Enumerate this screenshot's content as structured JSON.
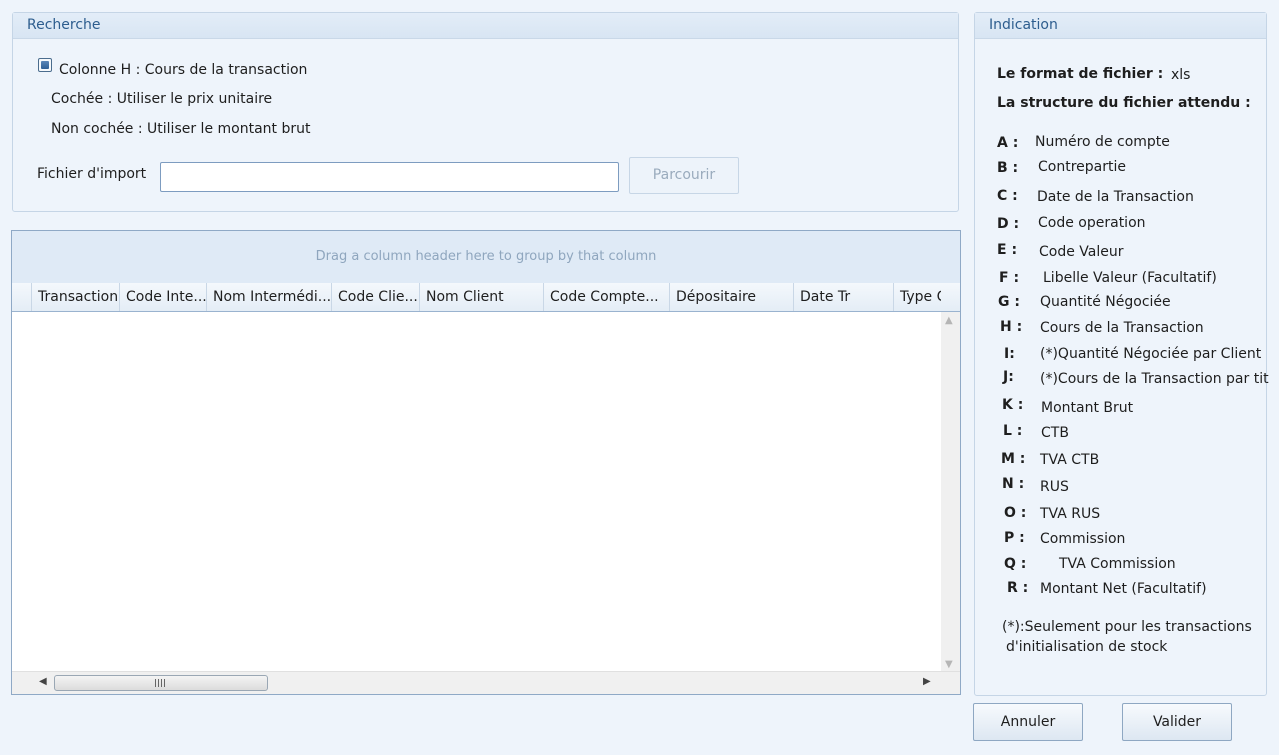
{
  "search_panel": {
    "title": "Recherche",
    "checkbox_label": "Colonne H : Cours de la transaction",
    "checked_hint": "Cochée : Utiliser le prix unitaire",
    "unchecked_hint": "Non cochée : Utiliser le montant brut",
    "file_label": "Fichier d'import",
    "file_value": "",
    "browse_button": "Parcourir"
  },
  "grid": {
    "group_hint": "Drag a column header here to group by that column",
    "columns": [
      "Transaction",
      "Code Inte...",
      "Nom Intermédi...",
      "Code Clie...",
      "Nom Client",
      "Code Compte...",
      "Dépositaire",
      "Date Tr",
      "Type C"
    ]
  },
  "info_panel": {
    "title": "Indication",
    "format_label": "Le format de fichier :",
    "format_value": "xls",
    "structure_label": "La structure du fichier attendu :",
    "fields": [
      {
        "key": "A :",
        "value": "Numéro de compte"
      },
      {
        "key": "B :",
        "value": "Contrepartie"
      },
      {
        "key": "C :",
        "value": "Date de la Transaction"
      },
      {
        "key": "D :",
        "value": "Code operation"
      },
      {
        "key": "E :",
        "value": "Code Valeur"
      },
      {
        "key": "F :",
        "value": "Libelle Valeur (Facultatif)"
      },
      {
        "key": "G :",
        "value": "Quantité Négociée"
      },
      {
        "key": "H :",
        "value": "Cours de la Transaction"
      },
      {
        "key": "I:",
        "value": "(*)Quantité Négociée par Client"
      },
      {
        "key": "J:",
        "value": "(*)Cours de la Transaction par tit"
      },
      {
        "key": "K :",
        "value": "Montant Brut"
      },
      {
        "key": "L :",
        "value": "CTB"
      },
      {
        "key": "M :",
        "value": "TVA CTB"
      },
      {
        "key": "N :",
        "value": "RUS"
      },
      {
        "key": "O :",
        "value": "TVA RUS"
      },
      {
        "key": "P :",
        "value": "Commission"
      },
      {
        "key": "Q :",
        "value": "TVA Commission"
      },
      {
        "key": "R :",
        "value": "Montant Net (Facultatif)"
      }
    ],
    "footnote_line1": "(*):Seulement pour les transactions",
    "footnote_line2": "d'initialisation de stock"
  },
  "actions": {
    "cancel": "Annuler",
    "validate": "Valider"
  }
}
